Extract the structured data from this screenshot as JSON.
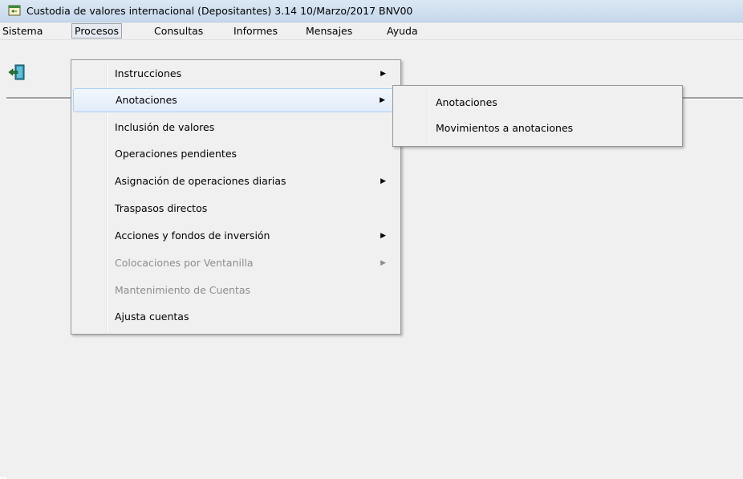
{
  "window": {
    "title": "Custodia de valores internacional (Depositantes) 3.14 10/Marzo/2017 BNV00"
  },
  "menubar": {
    "items": [
      {
        "label": "Sistema"
      },
      {
        "label": "Procesos"
      },
      {
        "label": "Consultas"
      },
      {
        "label": "Informes"
      },
      {
        "label": "Mensajes"
      },
      {
        "label": "Ayuda"
      }
    ],
    "active": "Procesos"
  },
  "toolbar": {
    "exit_icon": "exit-door-icon"
  },
  "procesos_menu": {
    "items": [
      {
        "label": "Instrucciones",
        "submenu": true,
        "enabled": true
      },
      {
        "label": "Anotaciones",
        "submenu": true,
        "enabled": true,
        "highlighted": true
      },
      {
        "label": "Inclusión de valores",
        "submenu": false,
        "enabled": true
      },
      {
        "label": "Operaciones pendientes",
        "submenu": false,
        "enabled": true
      },
      {
        "label": "Asignación de operaciones diarias",
        "submenu": true,
        "enabled": true
      },
      {
        "label": "Traspasos directos",
        "submenu": false,
        "enabled": true
      },
      {
        "label": "Acciones y fondos de inversión",
        "submenu": true,
        "enabled": true
      },
      {
        "label": "Colocaciones por Ventanilla",
        "submenu": true,
        "enabled": false
      },
      {
        "label": "Mantenimiento de Cuentas",
        "submenu": false,
        "enabled": false
      },
      {
        "label": "Ajusta cuentas",
        "submenu": false,
        "enabled": true
      }
    ]
  },
  "anotaciones_submenu": {
    "items": [
      {
        "label": "Anotaciones"
      },
      {
        "label": "Movimientos a anotaciones"
      }
    ]
  },
  "colors": {
    "menu_bg": "#f0f0f0",
    "highlight_border": "#aecff7",
    "disabled_text": "#8d8d8d"
  }
}
